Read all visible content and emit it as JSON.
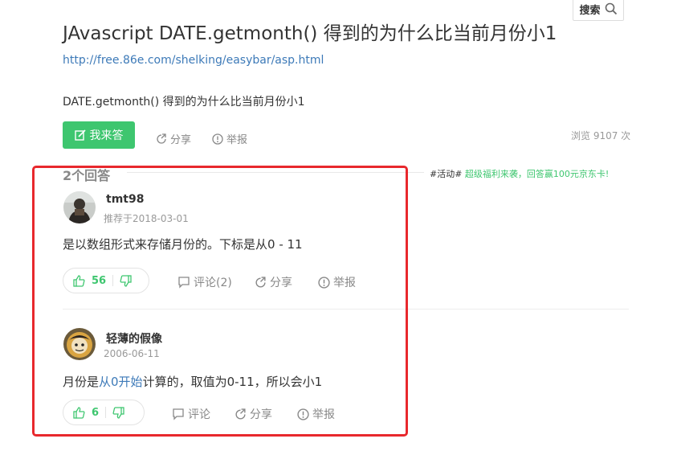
{
  "question": {
    "title": "JAvascript DATE.getmonth() 得到的为什么比当前月份小1",
    "source_link": "http://free.86e.com/shelking/easybar/asp.html",
    "description": "DATE.getmonth() 得到的为什么比当前月份小1"
  },
  "search": {
    "label": "搜索"
  },
  "actions": {
    "answer_label": "我来答",
    "share_label": "分享",
    "report_label": "举报",
    "views_text": "浏览 9107 次"
  },
  "answers_section": {
    "count_title": "2个回答",
    "promo_tag": "#活动#",
    "promo_text": " 超级福利来袭，回答赢100元京东卡!"
  },
  "answers": [
    {
      "user": "tmt98",
      "date": "推荐于2018-03-01",
      "text": "是以数组形式来存储月份的。下标是从0 - 11",
      "up_count": "56",
      "comment_label": "评论(2)",
      "share_label": "分享",
      "report_label": "举报"
    },
    {
      "user": "轻薄的假像",
      "date": "2006-06-11",
      "text_before": "月份是",
      "text_link": "从0开始",
      "text_after": "计算的，取值为0-11，所以会小1",
      "up_count": "6",
      "comment_label": "评论",
      "share_label": "分享",
      "report_label": "举报"
    }
  ],
  "colors": {
    "accent_green": "#3ec66f",
    "link_blue": "#3d7ab8",
    "highlight_red": "#e8282d"
  }
}
